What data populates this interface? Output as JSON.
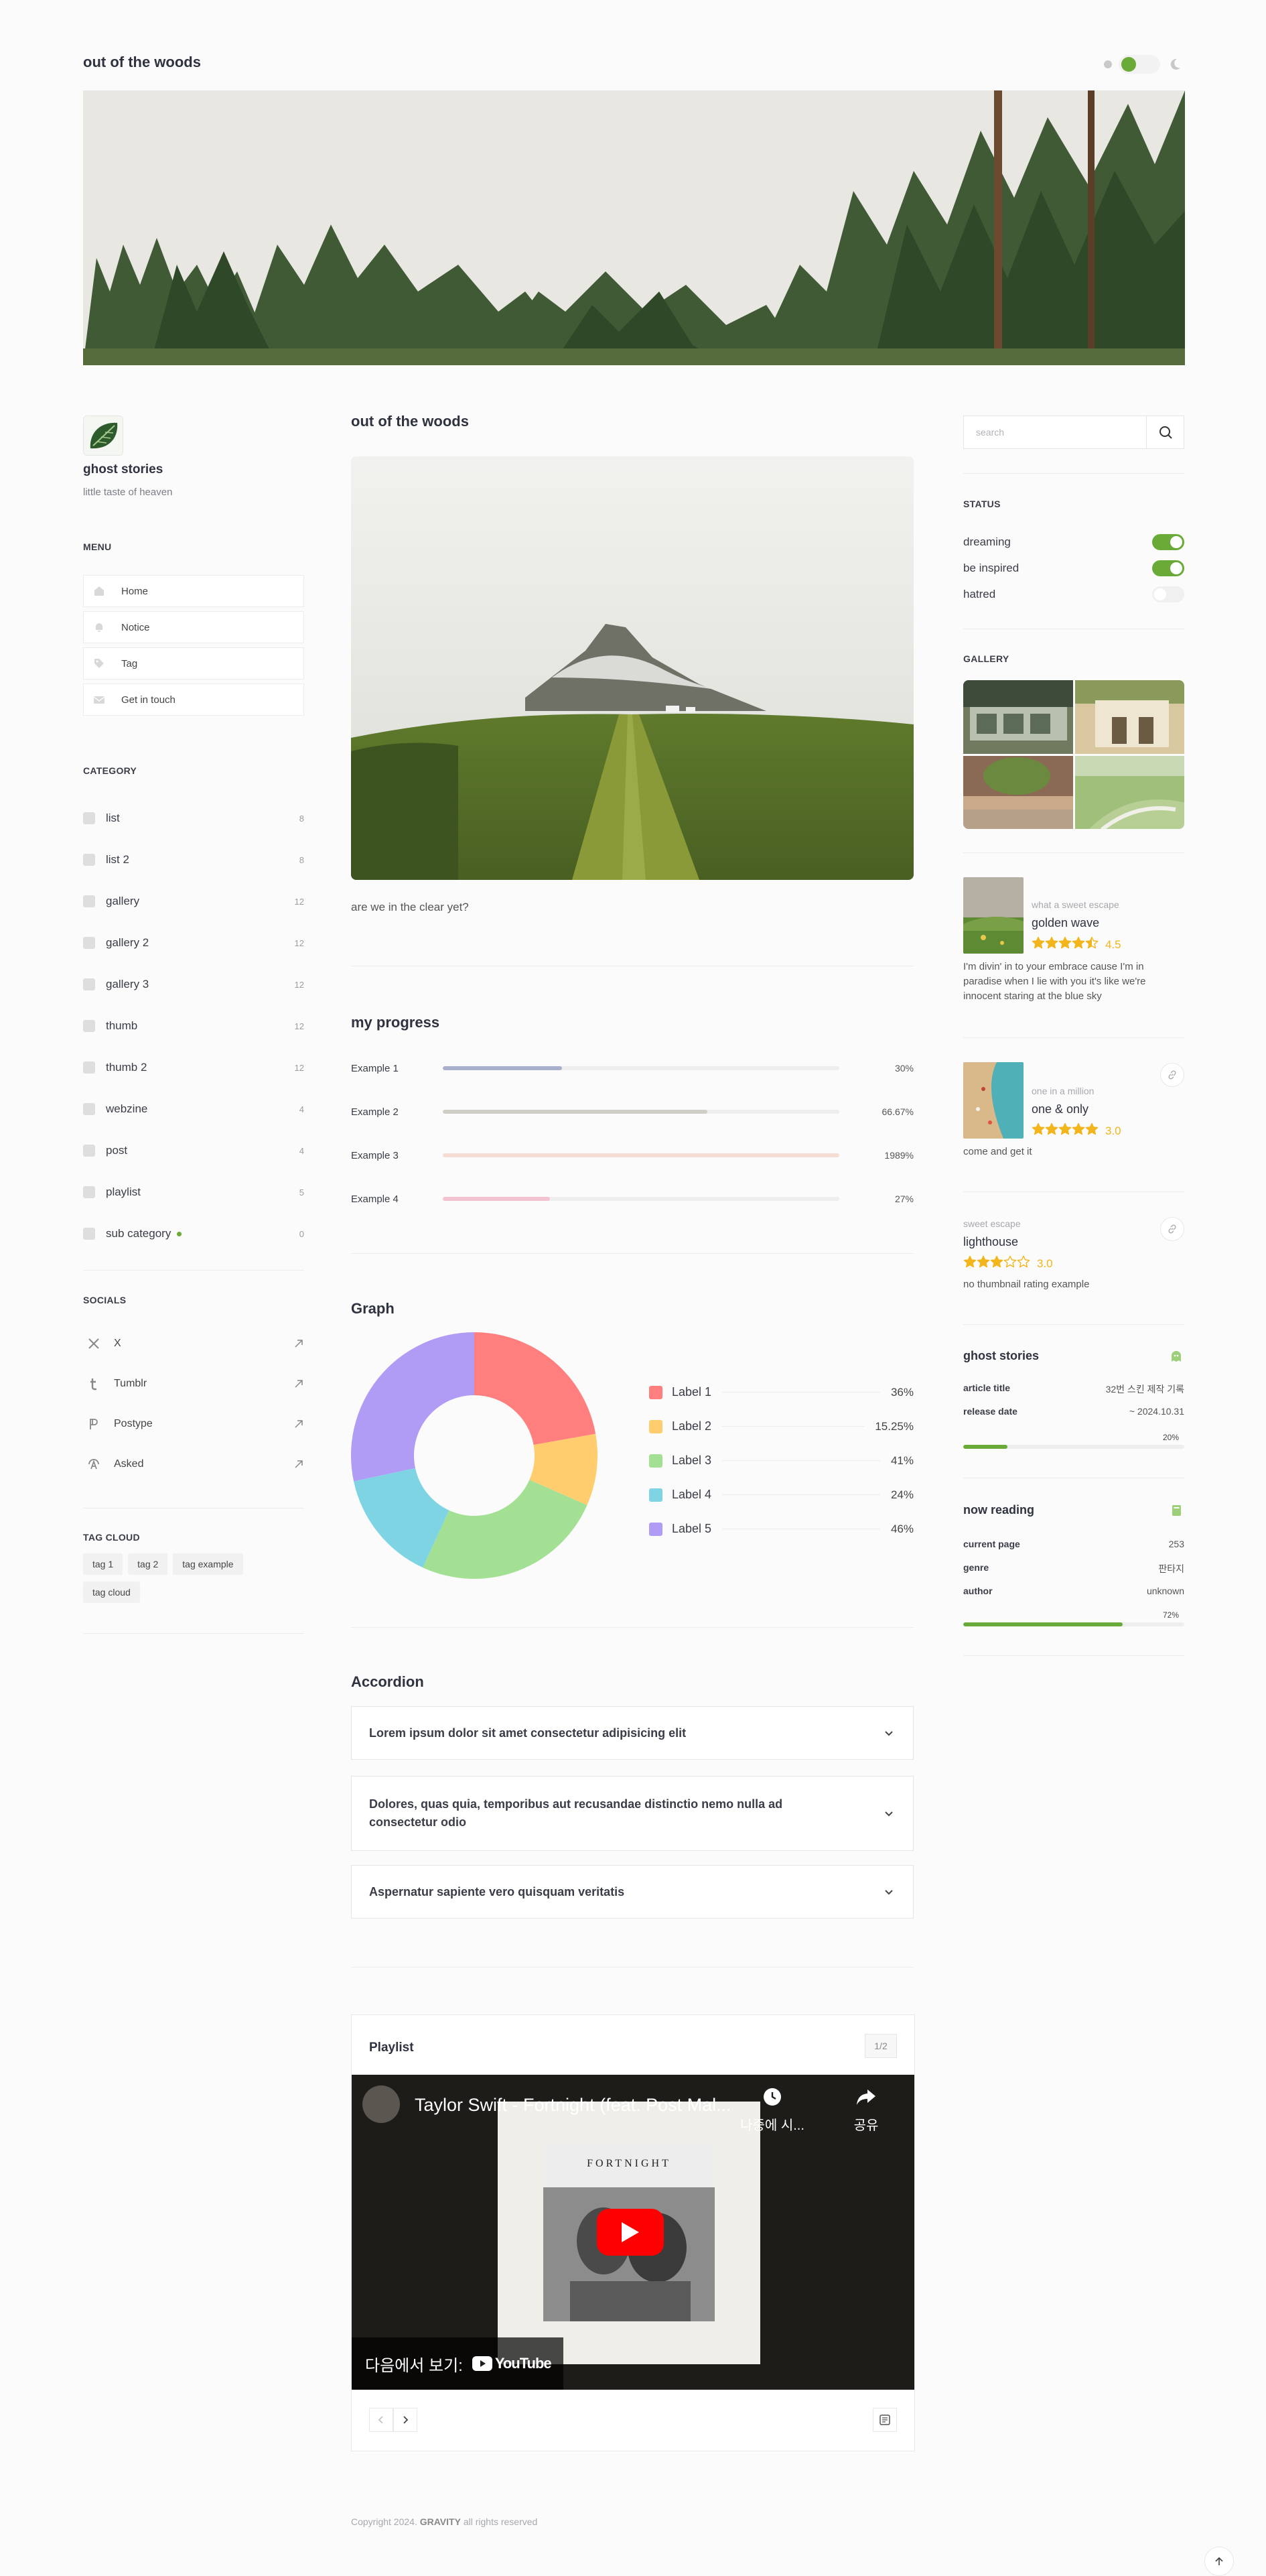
{
  "site": {
    "title": "out of the woods"
  },
  "profile": {
    "name": "ghost stories",
    "description": "little taste of heaven"
  },
  "menu": {
    "heading": "MENU",
    "items": [
      {
        "label": "Home",
        "icon": "home-icon"
      },
      {
        "label": "Notice",
        "icon": "bell-icon"
      },
      {
        "label": "Tag",
        "icon": "tag-icon"
      },
      {
        "label": "Get in touch",
        "icon": "mail-icon"
      }
    ]
  },
  "category": {
    "heading": "CATEGORY",
    "items": [
      {
        "label": "list",
        "count": "8"
      },
      {
        "label": "list 2",
        "count": "8"
      },
      {
        "label": "gallery",
        "count": "12"
      },
      {
        "label": "gallery 2",
        "count": "12"
      },
      {
        "label": "gallery 3",
        "count": "12"
      },
      {
        "label": "thumb",
        "count": "12"
      },
      {
        "label": "thumb 2",
        "count": "12"
      },
      {
        "label": "webzine",
        "count": "4"
      },
      {
        "label": "post",
        "count": "4"
      },
      {
        "label": "playlist",
        "count": "5"
      },
      {
        "label": "sub category",
        "count": "0",
        "new": true
      }
    ]
  },
  "socials": {
    "heading": "SOCIALS",
    "items": [
      {
        "label": "X",
        "icon": "x-icon"
      },
      {
        "label": "Tumblr",
        "icon": "tumblr-icon"
      },
      {
        "label": "Postype",
        "icon": "postype-icon"
      },
      {
        "label": "Asked",
        "icon": "asked-icon"
      }
    ]
  },
  "tag_cloud": {
    "heading": "TAG CLOUD",
    "tags": [
      "tag 1",
      "tag 2",
      "tag example",
      "tag cloud"
    ]
  },
  "post": {
    "title": "out of the woods",
    "caption": "are we in the clear yet?"
  },
  "progress": {
    "title": "my progress",
    "items": [
      {
        "label": "Example 1",
        "value": "30%",
        "fill": 0.3,
        "color": "#a9b0cc"
      },
      {
        "label": "Example 2",
        "value": "66.67%",
        "fill": 0.6667,
        "color": "#d0ccc6"
      },
      {
        "label": "Example 3",
        "value": "1989%",
        "fill": 1.0,
        "color": "#f6ddd3"
      },
      {
        "label": "Example 4",
        "value": "27%",
        "fill": 0.27,
        "color": "#f2c2cf"
      }
    ]
  },
  "graph": {
    "title": "Graph",
    "chart_data": {
      "type": "pie",
      "categories": [
        "Label 1",
        "Label 2",
        "Label 3",
        "Label 4",
        "Label 5"
      ],
      "labels": [
        "36%",
        "15.25%",
        "41%",
        "24%",
        "46%"
      ],
      "values": [
        36,
        15.25,
        41,
        24,
        46
      ],
      "colors": [
        "#ff7f7f",
        "#ffcc6e",
        "#a4e094",
        "#7fd4e3",
        "#b09cf5"
      ]
    }
  },
  "accordion": {
    "title": "Accordion",
    "items": [
      "Lorem ipsum dolor sit amet consectetur adipisicing elit",
      "Dolores, quas quia, temporibus aut recusandae distinctio nemo nulla ad consectetur odio",
      "Aspernatur sapiente vero quisquam veritatis"
    ]
  },
  "playlist": {
    "title": "Playlist",
    "page": "1/2",
    "video_title": "Taylor Swift - Fortnight (feat. Post Mal...",
    "watch_later": "나중에 시...",
    "share": "공유",
    "watch_on": "다음에서 보기:",
    "youtube": "YouTube",
    "album_title": "FORTNIGHT"
  },
  "search": {
    "placeholder": "search"
  },
  "status": {
    "heading": "STATUS",
    "items": [
      {
        "label": "dreaming",
        "on": true
      },
      {
        "label": "be inspired",
        "on": true
      },
      {
        "label": "hatred",
        "on": false
      }
    ]
  },
  "gallery": {
    "heading": "GALLERY"
  },
  "cards": [
    {
      "sub": "what a sweet escape",
      "title": "golden wave",
      "rating": "4.5",
      "desc": "I'm divin' in to your embrace cause I'm in paradise when I lie with you it's like we're innocent staring at the blue sky"
    },
    {
      "sub": "one in a million",
      "title": "one & only",
      "rating": "3.0",
      "desc": "come and get it"
    },
    {
      "sub": "sweet escape",
      "title": "lighthouse",
      "rating": "3.0",
      "desc": "no thumbnail rating example"
    }
  ],
  "info1": {
    "title": "ghost stories",
    "rows": [
      {
        "key": "article title",
        "val": "32번 스킨 제작 기록"
      },
      {
        "key": "release date",
        "val": "~ 2024.10.31"
      }
    ],
    "percent": "20%",
    "fill": 0.2
  },
  "info2": {
    "title": "now reading",
    "rows": [
      {
        "key": "current page",
        "val": "253"
      },
      {
        "key": "genre",
        "val": "판타지"
      },
      {
        "key": "author",
        "val": "unknown"
      }
    ],
    "percent": "72%",
    "fill": 0.72
  },
  "footer": {
    "copyright": "Copyright 2024.",
    "brand": "GRAVITY",
    "rights": "all rights reserved"
  },
  "accent": "#6aaa37"
}
